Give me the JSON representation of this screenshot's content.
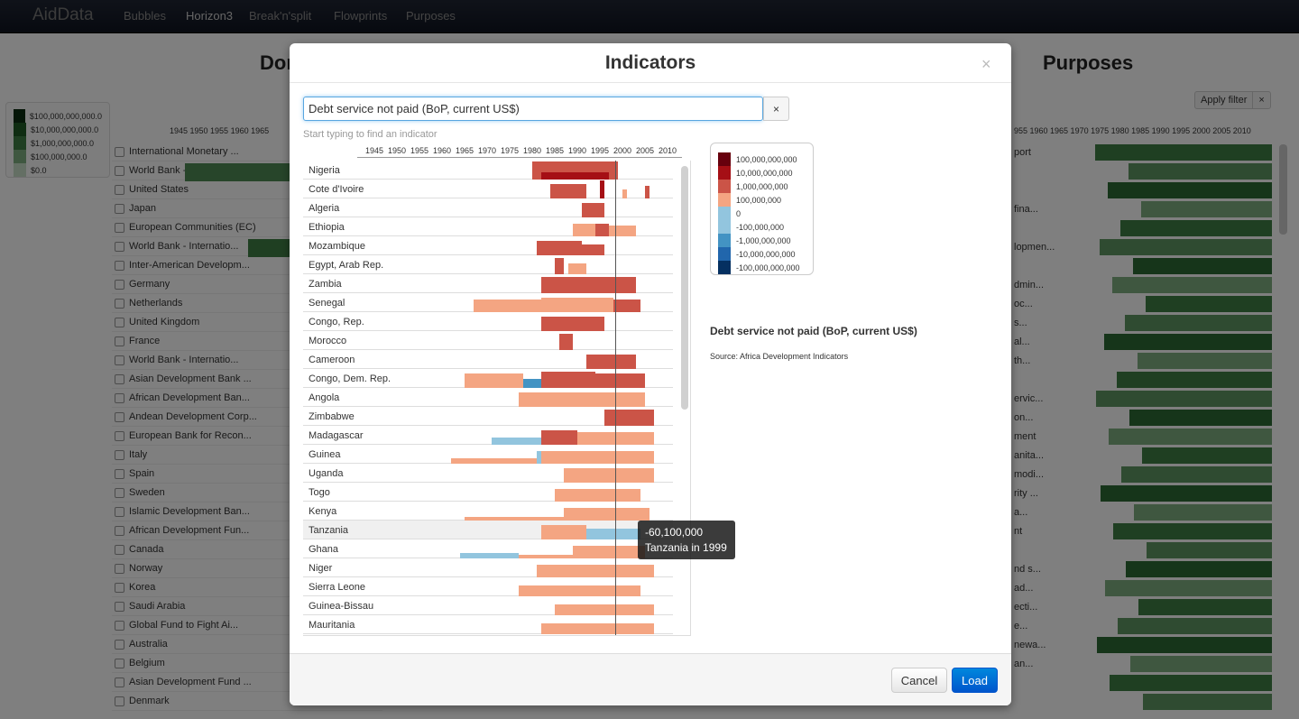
{
  "navbar": {
    "brand": "AidData",
    "items": [
      {
        "label": "Bubbles",
        "active": false
      },
      {
        "label": "Horizon3",
        "active": true
      },
      {
        "label": "Break'n'split",
        "active": false
      },
      {
        "label": "Flowprints",
        "active": false
      },
      {
        "label": "Purposes",
        "active": false
      }
    ]
  },
  "background": {
    "left_heading": "Dor",
    "right_heading": "Purposes",
    "apply_filter": "Apply filter",
    "apply_close": "×",
    "legend": [
      {
        "label": "$100,000,000,000.0",
        "color": "#0b2c10"
      },
      {
        "label": "$10,000,000,000.0",
        "color": "#1e5a25"
      },
      {
        "label": "$1,000,000,000.0",
        "color": "#3f7f45"
      },
      {
        "label": "$100,000,000.0",
        "color": "#7fae81"
      },
      {
        "label": "$0.0",
        "color": "#c9dfc9"
      }
    ],
    "left_axis": "1945 1950 1955 1960 1965",
    "right_axis": "955 1960 1965 1970 1975 1980 1985 1990 1995 2000 2005 2010",
    "donors": [
      "International Monetary ...",
      "World Bank - Internatio...",
      "United States",
      "Japan",
      "European Communities (EC)",
      "World Bank - Internatio...",
      "Inter-American Developm...",
      "Germany",
      "Netherlands",
      "United Kingdom",
      "France",
      "World Bank - Internatio...",
      "Asian Development Bank ...",
      "African Development Ban...",
      "Andean Development Corp...",
      "European Bank for Recon...",
      "Italy",
      "Spain",
      "Sweden",
      "Islamic Development Ban...",
      "African Development Fun...",
      "Canada",
      "Norway",
      "Korea",
      "Saudi Arabia",
      "Global Fund to Fight Ai...",
      "Australia",
      "Belgium",
      "Asian Development Fund ...",
      "Denmark"
    ],
    "purposes": [
      "port",
      "",
      "",
      "fina...",
      "",
      "lopmen...",
      "",
      "dmin...",
      "oc...",
      "s...",
      "al...",
      "th...",
      "",
      "ervic...",
      "on...",
      "ment",
      "anita...",
      "modi...",
      "rity ...",
      "a...",
      "nt",
      "",
      "nd s...",
      "ad...",
      "ecti...",
      "e...",
      "newa...",
      "an..."
    ]
  },
  "modal": {
    "title": "Indicators",
    "close": "×",
    "search_value": "Debt service not paid (BoP, current US$)",
    "search_placeholder": "Start typing to find an indicator",
    "clear": "×",
    "hint": "Start typing to find an indicator",
    "years": [
      "1945",
      "1950",
      "1955",
      "1960",
      "1965",
      "1970",
      "1975",
      "1980",
      "1985",
      "1990",
      "1995",
      "2000",
      "2005",
      "2010"
    ],
    "countries": [
      "Nigeria",
      "Cote d'Ivoire",
      "Algeria",
      "Ethiopia",
      "Mozambique",
      "Egypt, Arab Rep.",
      "Zambia",
      "Senegal",
      "Congo, Rep.",
      "Morocco",
      "Cameroon",
      "Congo, Dem. Rep.",
      "Angola",
      "Zimbabwe",
      "Madagascar",
      "Guinea",
      "Uganda",
      "Togo",
      "Kenya",
      "Tanzania",
      "Ghana",
      "Niger",
      "Sierra Leone",
      "Guinea-Bissau",
      "Mauritania"
    ],
    "highlighted_country": "Tanzania",
    "tooltip": {
      "value": "-60,100,000",
      "label": "Tanzania in 1999"
    },
    "legend": [
      {
        "label": "100,000,000,000",
        "color": "#67000d"
      },
      {
        "label": "10,000,000,000",
        "color": "#a50f15"
      },
      {
        "label": "1,000,000,000",
        "color": "#cb5447"
      },
      {
        "label": "100,000,000",
        "color": "#f4a582"
      },
      {
        "label": "0",
        "color": "#92c5de"
      },
      {
        "label": "-100,000,000",
        "color": "#92c5de"
      },
      {
        "label": "-1,000,000,000",
        "color": "#4393c3"
      },
      {
        "label": "-10,000,000,000",
        "color": "#2166ac"
      },
      {
        "label": "-100,000,000,000",
        "color": "#053061"
      }
    ],
    "info_title": "Debt service not paid (BoP, current US$)",
    "info_source": "Source: Africa Development Indicators",
    "cancel": "Cancel",
    "load": "Load"
  }
}
